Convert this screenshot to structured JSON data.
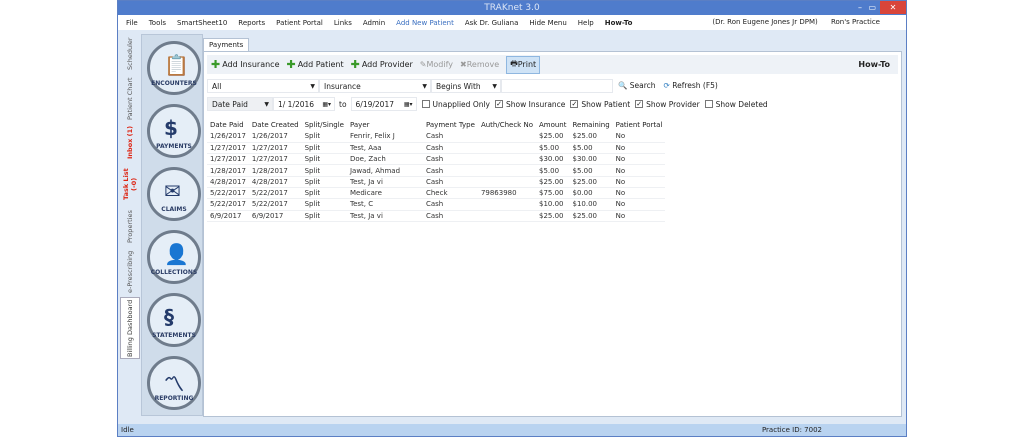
{
  "window": {
    "title": "TRAKnet 3.0"
  },
  "menu": {
    "items": [
      "File",
      "Tools",
      "SmartSheet10",
      "Reports",
      "Patient Portal",
      "Links",
      "Admin",
      "Add New Patient",
      "Ask Dr. Guliana",
      "Hide Menu",
      "Help",
      "How-To"
    ],
    "user": "(Dr. Ron Eugene Jones Jr DPM)",
    "practice": "Ron's Practice"
  },
  "vtabs": [
    "Scheduler",
    "Patient Chart",
    "Inbox (1)",
    "Task List (-0)",
    "Properties",
    "e-Prescribing",
    "Billing Dashboard"
  ],
  "modules": [
    "ENCOUNTERS",
    "PAYMENTS",
    "CLAIMS",
    "COLLECTIONS",
    "STATEMENTS",
    "REPORTING"
  ],
  "tab": "Payments",
  "toolbar": {
    "add_insurance": "Add Insurance",
    "add_patient": "Add Patient",
    "add_provider": "Add Provider",
    "modify": "Modify",
    "remove": "Remove",
    "print": "Print",
    "howto": "How-To"
  },
  "filter": {
    "scope": "All",
    "field": "Insurance",
    "match": "Begins With",
    "value": "",
    "search": "Search",
    "refresh": "Refresh (F5)"
  },
  "dates": {
    "type": "Date Paid",
    "from": "1/ 1/2016",
    "to_label": "to",
    "to": "6/19/2017"
  },
  "checks": [
    {
      "label": "Unapplied Only",
      "checked": false
    },
    {
      "label": "Show Insurance",
      "checked": true
    },
    {
      "label": "Show Patient",
      "checked": true
    },
    {
      "label": "Show Provider",
      "checked": true
    },
    {
      "label": "Show Deleted",
      "checked": false
    }
  ],
  "table": {
    "columns": [
      "Date Paid",
      "Date Created",
      "Split/Single",
      "Payer",
      "Payment Type",
      "Auth/Check No",
      "Amount",
      "Remaining",
      "Patient Portal"
    ],
    "rows": [
      [
        "1/26/2017",
        "1/26/2017",
        "Split",
        "Fenrir, Felix J",
        "Cash",
        "",
        "$25.00",
        "$25.00",
        "No"
      ],
      [
        "1/27/2017",
        "1/27/2017",
        "Split",
        "Test, Aaa",
        "Cash",
        "",
        "$5.00",
        "$5.00",
        "No"
      ],
      [
        "1/27/2017",
        "1/27/2017",
        "Split",
        "Doe, Zach",
        "Cash",
        "",
        "$30.00",
        "$30.00",
        "No"
      ],
      [
        "1/28/2017",
        "1/28/2017",
        "Split",
        "Jawad, Ahmad",
        "Cash",
        "",
        "$5.00",
        "$5.00",
        "No"
      ],
      [
        "4/28/2017",
        "4/28/2017",
        "Split",
        "Test, Ja vi",
        "Cash",
        "",
        "$25.00",
        "$25.00",
        "No"
      ],
      [
        "5/22/2017",
        "5/22/2017",
        "Split",
        "Medicare",
        "Check",
        "79863980",
        "$75.00",
        "$0.00",
        "No"
      ],
      [
        "5/22/2017",
        "5/22/2017",
        "Split",
        "Test, C",
        "Cash",
        "",
        "$10.00",
        "$10.00",
        "No"
      ],
      [
        "6/9/2017",
        "6/9/2017",
        "Split",
        "Test, Ja vi",
        "Cash",
        "",
        "$25.00",
        "$25.00",
        "No"
      ]
    ]
  },
  "status": {
    "state": "Idle",
    "practice_id": "Practice ID: 7002"
  }
}
